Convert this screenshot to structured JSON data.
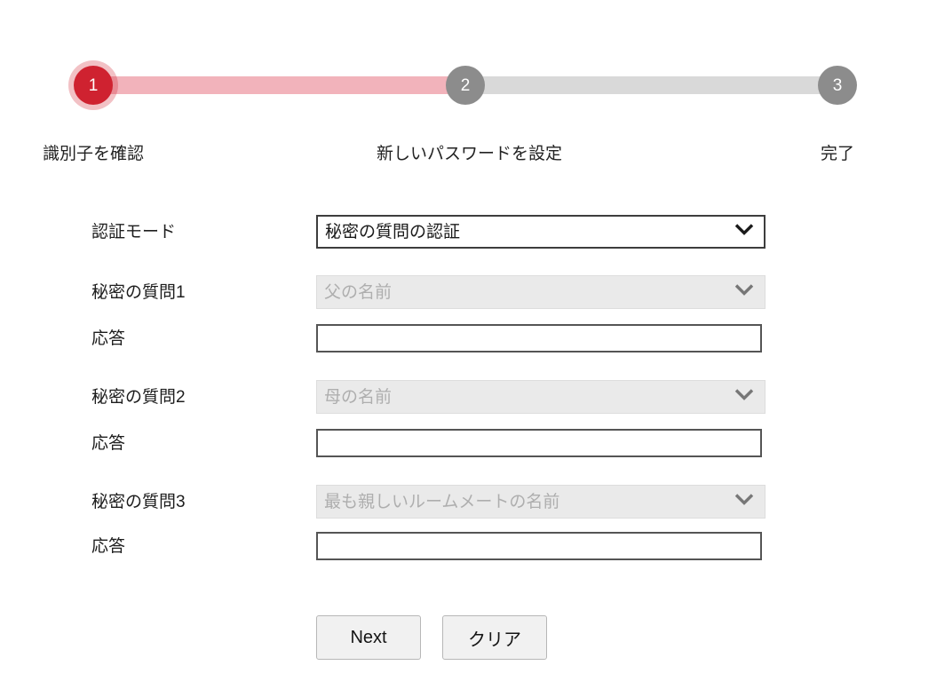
{
  "stepper": {
    "steps": [
      {
        "number": "1",
        "label": "識別子を確認",
        "state": "active"
      },
      {
        "number": "2",
        "label": "新しいパスワードを設定",
        "state": "inactive"
      },
      {
        "number": "3",
        "label": "完了",
        "state": "inactive"
      }
    ],
    "colors": {
      "active_circle": "#cf2230",
      "active_halo": "#f2b3bb",
      "inactive_circle": "#8c8c8c",
      "completed_track": "#f2b3bb",
      "pending_track": "#d9d9d9"
    }
  },
  "form": {
    "auth_mode": {
      "label": "認証モード",
      "value": "秘密の質問の認証",
      "options": [
        "秘密の質問の認証"
      ],
      "disabled": false
    },
    "questions": [
      {
        "question_label": "秘密の質問1",
        "question_value": "父の名前",
        "question_disabled": true,
        "answer_label": "応答",
        "answer_value": "",
        "answer_placeholder": ""
      },
      {
        "question_label": "秘密の質問2",
        "question_value": "母の名前",
        "question_disabled": true,
        "answer_label": "応答",
        "answer_value": "",
        "answer_placeholder": ""
      },
      {
        "question_label": "秘密の質問3",
        "question_value": "最も親しいルームメートの名前",
        "question_disabled": true,
        "answer_label": "応答",
        "answer_value": "",
        "answer_placeholder": ""
      }
    ]
  },
  "buttons": {
    "next_label": "Next",
    "clear_label": "クリア"
  },
  "icons": {
    "dropdown": "chevron-down-icon"
  }
}
